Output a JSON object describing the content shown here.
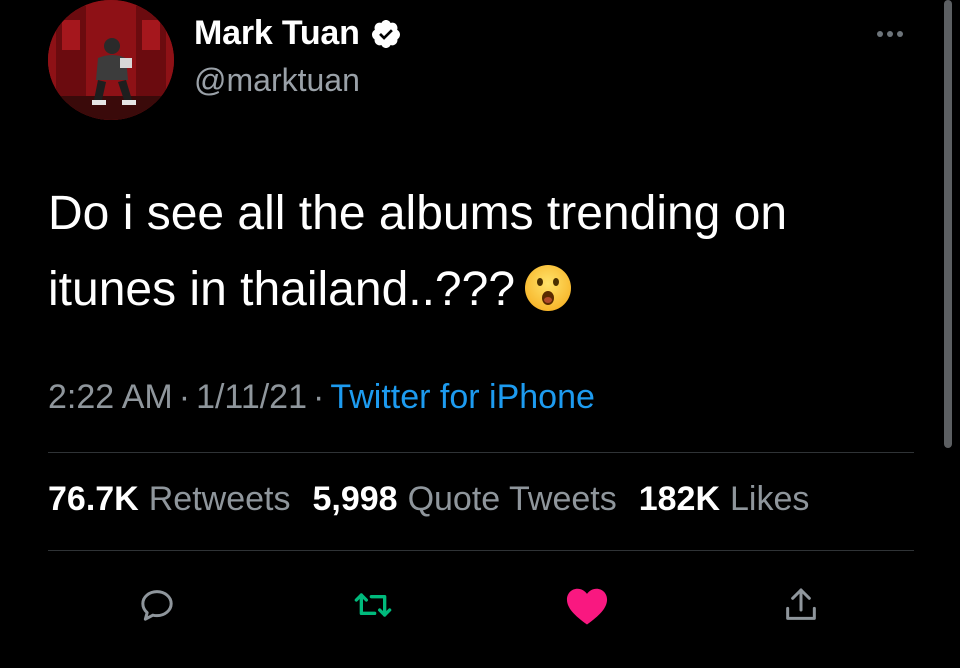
{
  "author": {
    "name": "Mark Tuan",
    "handle": "@marktuan",
    "verified": true
  },
  "tweet": {
    "text": "Do i see all the albums trending on itunes in thailand..???",
    "emoji": "😮",
    "time": "2:22 AM",
    "date": "1/11/21",
    "source": "Twitter for iPhone"
  },
  "stats": [
    {
      "value": "76.7K",
      "label": "Retweets"
    },
    {
      "value": "5,998",
      "label": "Quote Tweets"
    },
    {
      "value": "182K",
      "label": "Likes"
    }
  ],
  "icons": {
    "reply": "reply-icon",
    "retweet": "retweet-icon",
    "like": "heart-icon",
    "share": "share-icon",
    "more": "more-icon",
    "verified": "verified-badge-icon"
  },
  "colors": {
    "background": "#000000",
    "muted_text": "#8f969c",
    "link": "#1d9bf0",
    "retweet_green": "#00ba7c",
    "like_red": "#f91880",
    "divider": "#2f3336"
  }
}
